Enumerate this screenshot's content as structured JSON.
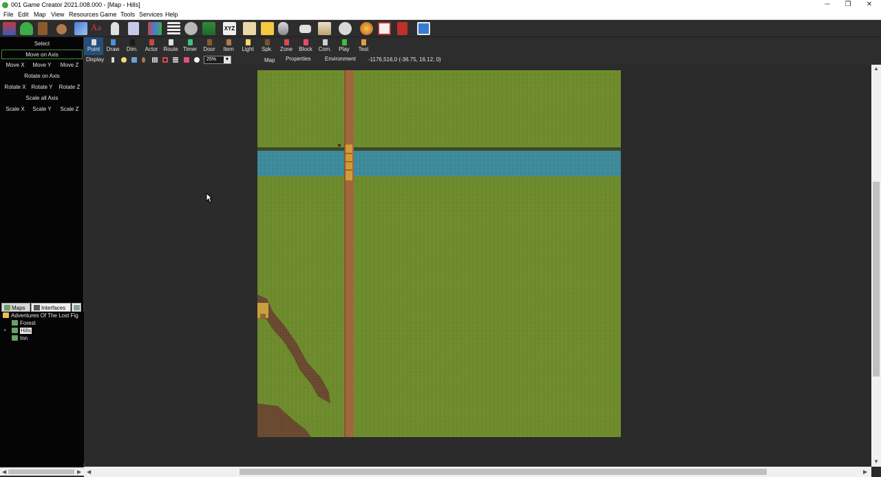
{
  "window": {
    "title": "001 Game Creator 2021.008.000 - [Map - Hills]",
    "buttons": {
      "minimize": "─",
      "restore": "❐",
      "close": "✕"
    }
  },
  "menu": [
    "File",
    "Edit",
    "Map",
    "View",
    "Resources",
    "Game",
    "Tools",
    "Services",
    "Help"
  ],
  "toolbar": {
    "icons": [
      "character-icon",
      "add-user-icon",
      "door-icon",
      "bag-icon",
      "music-icon",
      "font-icon",
      "person-icon",
      "document-icon",
      "group-icon",
      "list-icon",
      "gears-icon",
      "tree-icon",
      "xyz-icon",
      "scroll-icon",
      "note-icon",
      "database-icon",
      "gamepad-icon",
      "card-icon",
      "settings-icon",
      "ball-icon",
      "movie-icon",
      "video-icon",
      "save-icon"
    ],
    "xyz_label": "XYZ"
  },
  "left_panel": {
    "select": "Select",
    "move_on_axis": "Move on Axis",
    "move": [
      "Move X",
      "Move Y",
      "Move Z"
    ],
    "rotate_on_axis": "Rotate on Axis",
    "rotate": [
      "Rotate X",
      "Rotate Y",
      "Rotate Z"
    ],
    "scale_all_axis": "Scale all Axis",
    "scale": [
      "Scale X",
      "Scale Y",
      "Scale Z"
    ]
  },
  "tabs": {
    "maps": "Maps",
    "interfaces": "Interfaces"
  },
  "tree": {
    "root": "Adventures Of The Lost Fig",
    "items": [
      {
        "label": "Forest",
        "selected": false,
        "expandable": false
      },
      {
        "label": "Hills",
        "selected": true,
        "expandable": true
      },
      {
        "label": "Inn",
        "selected": false,
        "expandable": false
      }
    ]
  },
  "map_tools": [
    {
      "label": "Point",
      "color": "#d9d9d9",
      "selected": true
    },
    {
      "label": "Draw",
      "color": "#4a90d9",
      "selected": false
    },
    {
      "label": "Dim.",
      "color": "#1a1a1a",
      "selected": false
    },
    {
      "label": "Actor",
      "color": "#c04a4a",
      "selected": false
    },
    {
      "label": "Route",
      "color": "#e0e0e0",
      "selected": false
    },
    {
      "label": "Timer",
      "color": "#3fbf7f",
      "selected": false
    },
    {
      "label": "Door",
      "color": "#8a5a2b",
      "selected": false
    },
    {
      "label": "Item",
      "color": "#b07a4a",
      "selected": false
    },
    {
      "label": "Light",
      "color": "#f5d76e",
      "selected": false
    },
    {
      "label": "Spk.",
      "color": "#7a5230",
      "selected": false
    },
    {
      "label": "Zone",
      "color": "#d94a4a",
      "selected": false
    },
    {
      "label": "Block",
      "color": "#e84a6a",
      "selected": false
    },
    {
      "label": "Com.",
      "color": "#d0d0d0",
      "selected": false
    },
    {
      "label": "Play",
      "color": "#3fbf3f",
      "selected": false
    },
    {
      "label": "Test",
      "color": "#e0a040",
      "selected": false
    }
  ],
  "display_row": {
    "display": "Display",
    "zoom": "25%",
    "tabs": [
      "Map",
      "Properties",
      "Environment"
    ],
    "coordinates": "-1176,516,0 (-36.75, 16.12, 0)"
  },
  "colors": {
    "grass": "#6e8c2e",
    "road": "#a0673d",
    "water": "#3f8a9a",
    "dirt": "#6a4a30",
    "selection_outline": "#3e8f3e",
    "tree_selected": "#ffffff"
  }
}
